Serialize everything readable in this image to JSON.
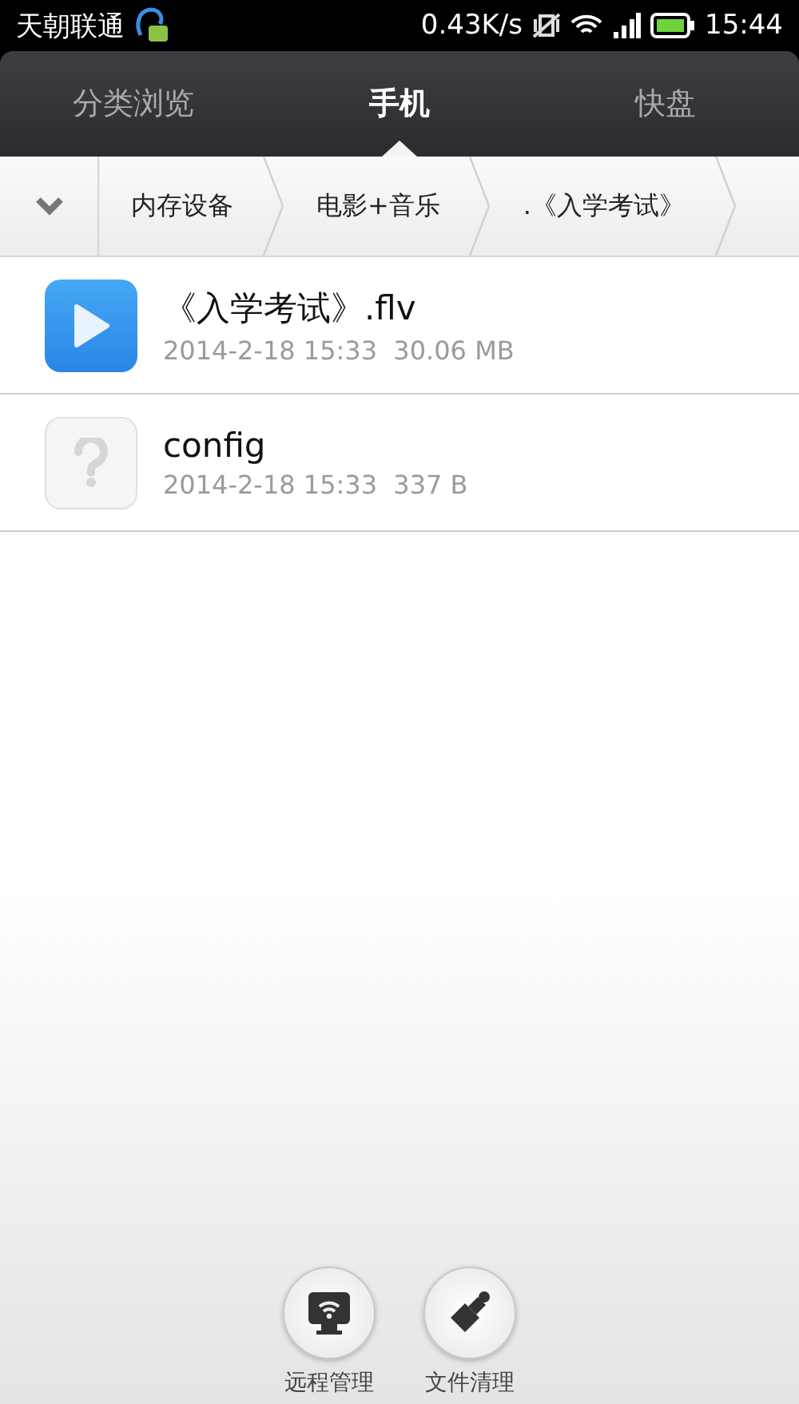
{
  "status_bar": {
    "carrier": "天朝联通",
    "speed": "0.43K/s",
    "time": "15:44"
  },
  "tabs": [
    {
      "label": "分类浏览",
      "selected": false
    },
    {
      "label": "手机",
      "selected": true
    },
    {
      "label": "快盘",
      "selected": false
    }
  ],
  "breadcrumb": [
    "内存设备",
    "电影+音乐",
    ".《入学考试》"
  ],
  "files": [
    {
      "kind": "video",
      "name": "《入学考试》.flv",
      "date": "2014-2-18 15:33",
      "size": "30.06 MB"
    },
    {
      "kind": "unknown",
      "name": "config",
      "date": "2014-2-18 15:33",
      "size": "337 B"
    }
  ],
  "actions": [
    {
      "kind": "remote",
      "label": "远程管理"
    },
    {
      "kind": "clean",
      "label": "文件清理"
    }
  ]
}
